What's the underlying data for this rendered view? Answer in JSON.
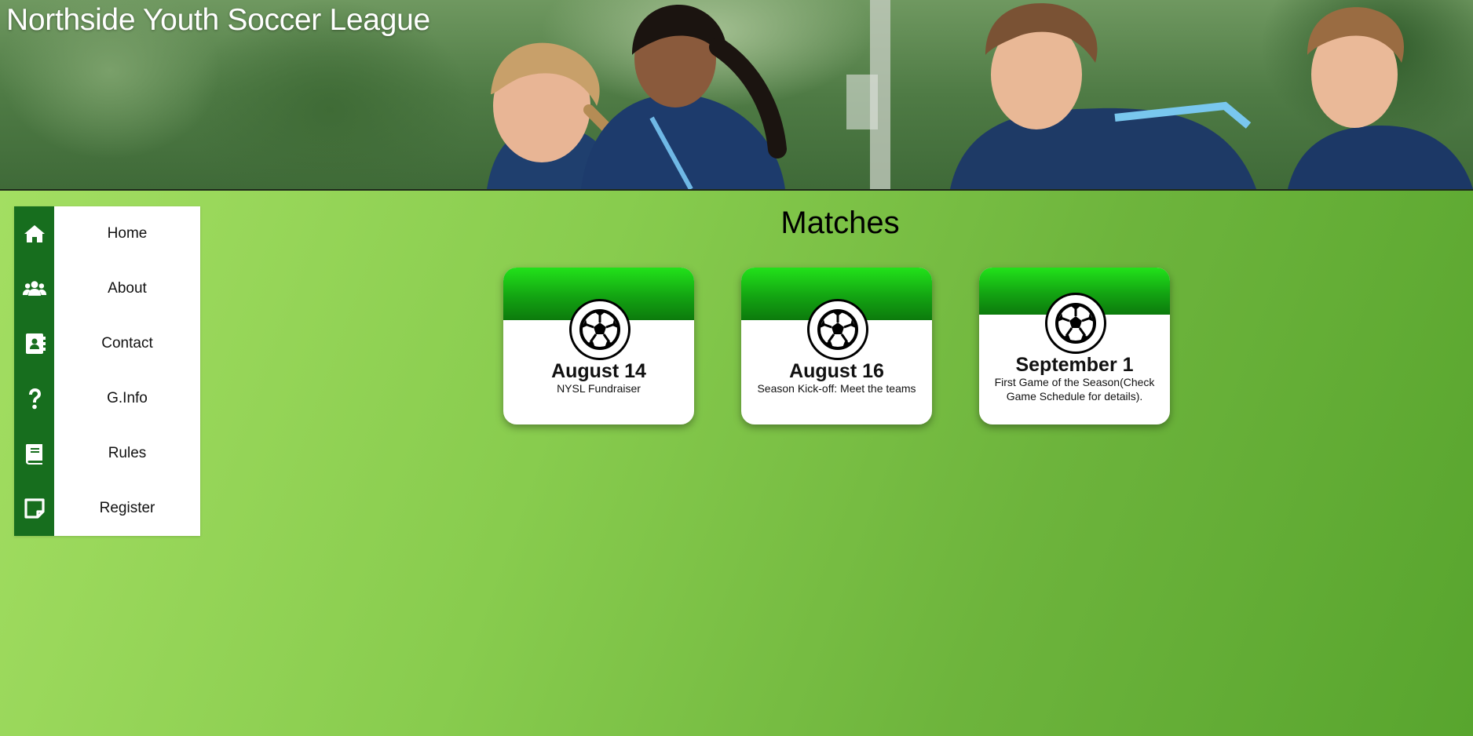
{
  "header": {
    "title": "Northside Youth Soccer League",
    "banner_image": "children-playing-soccer-photo"
  },
  "sidebar": {
    "items": [
      {
        "label": "Home",
        "icon": "home-icon"
      },
      {
        "label": "About",
        "icon": "users-icon"
      },
      {
        "label": "Contact",
        "icon": "address-book-icon"
      },
      {
        "label": "G.Info",
        "icon": "question-icon"
      },
      {
        "label": "Rules",
        "icon": "book-icon"
      },
      {
        "label": "Register",
        "icon": "sticky-note-icon"
      }
    ]
  },
  "main": {
    "title": "Matches",
    "cards": [
      {
        "date": "August 14",
        "description": "NYSL Fundraiser",
        "icon": "soccer-ball-icon"
      },
      {
        "date": "August 16",
        "description": "Season Kick-off: Meet the teams",
        "icon": "soccer-ball-icon"
      },
      {
        "date": "September 1",
        "description": "First Game of the Season(Check Game Schedule for details).",
        "icon": "soccer-ball-icon"
      }
    ]
  },
  "colors": {
    "sidebar_rail": "#176e1e",
    "card_header": "#1fd61a",
    "background_start": "#a6e064",
    "background_end": "#58a52e"
  }
}
